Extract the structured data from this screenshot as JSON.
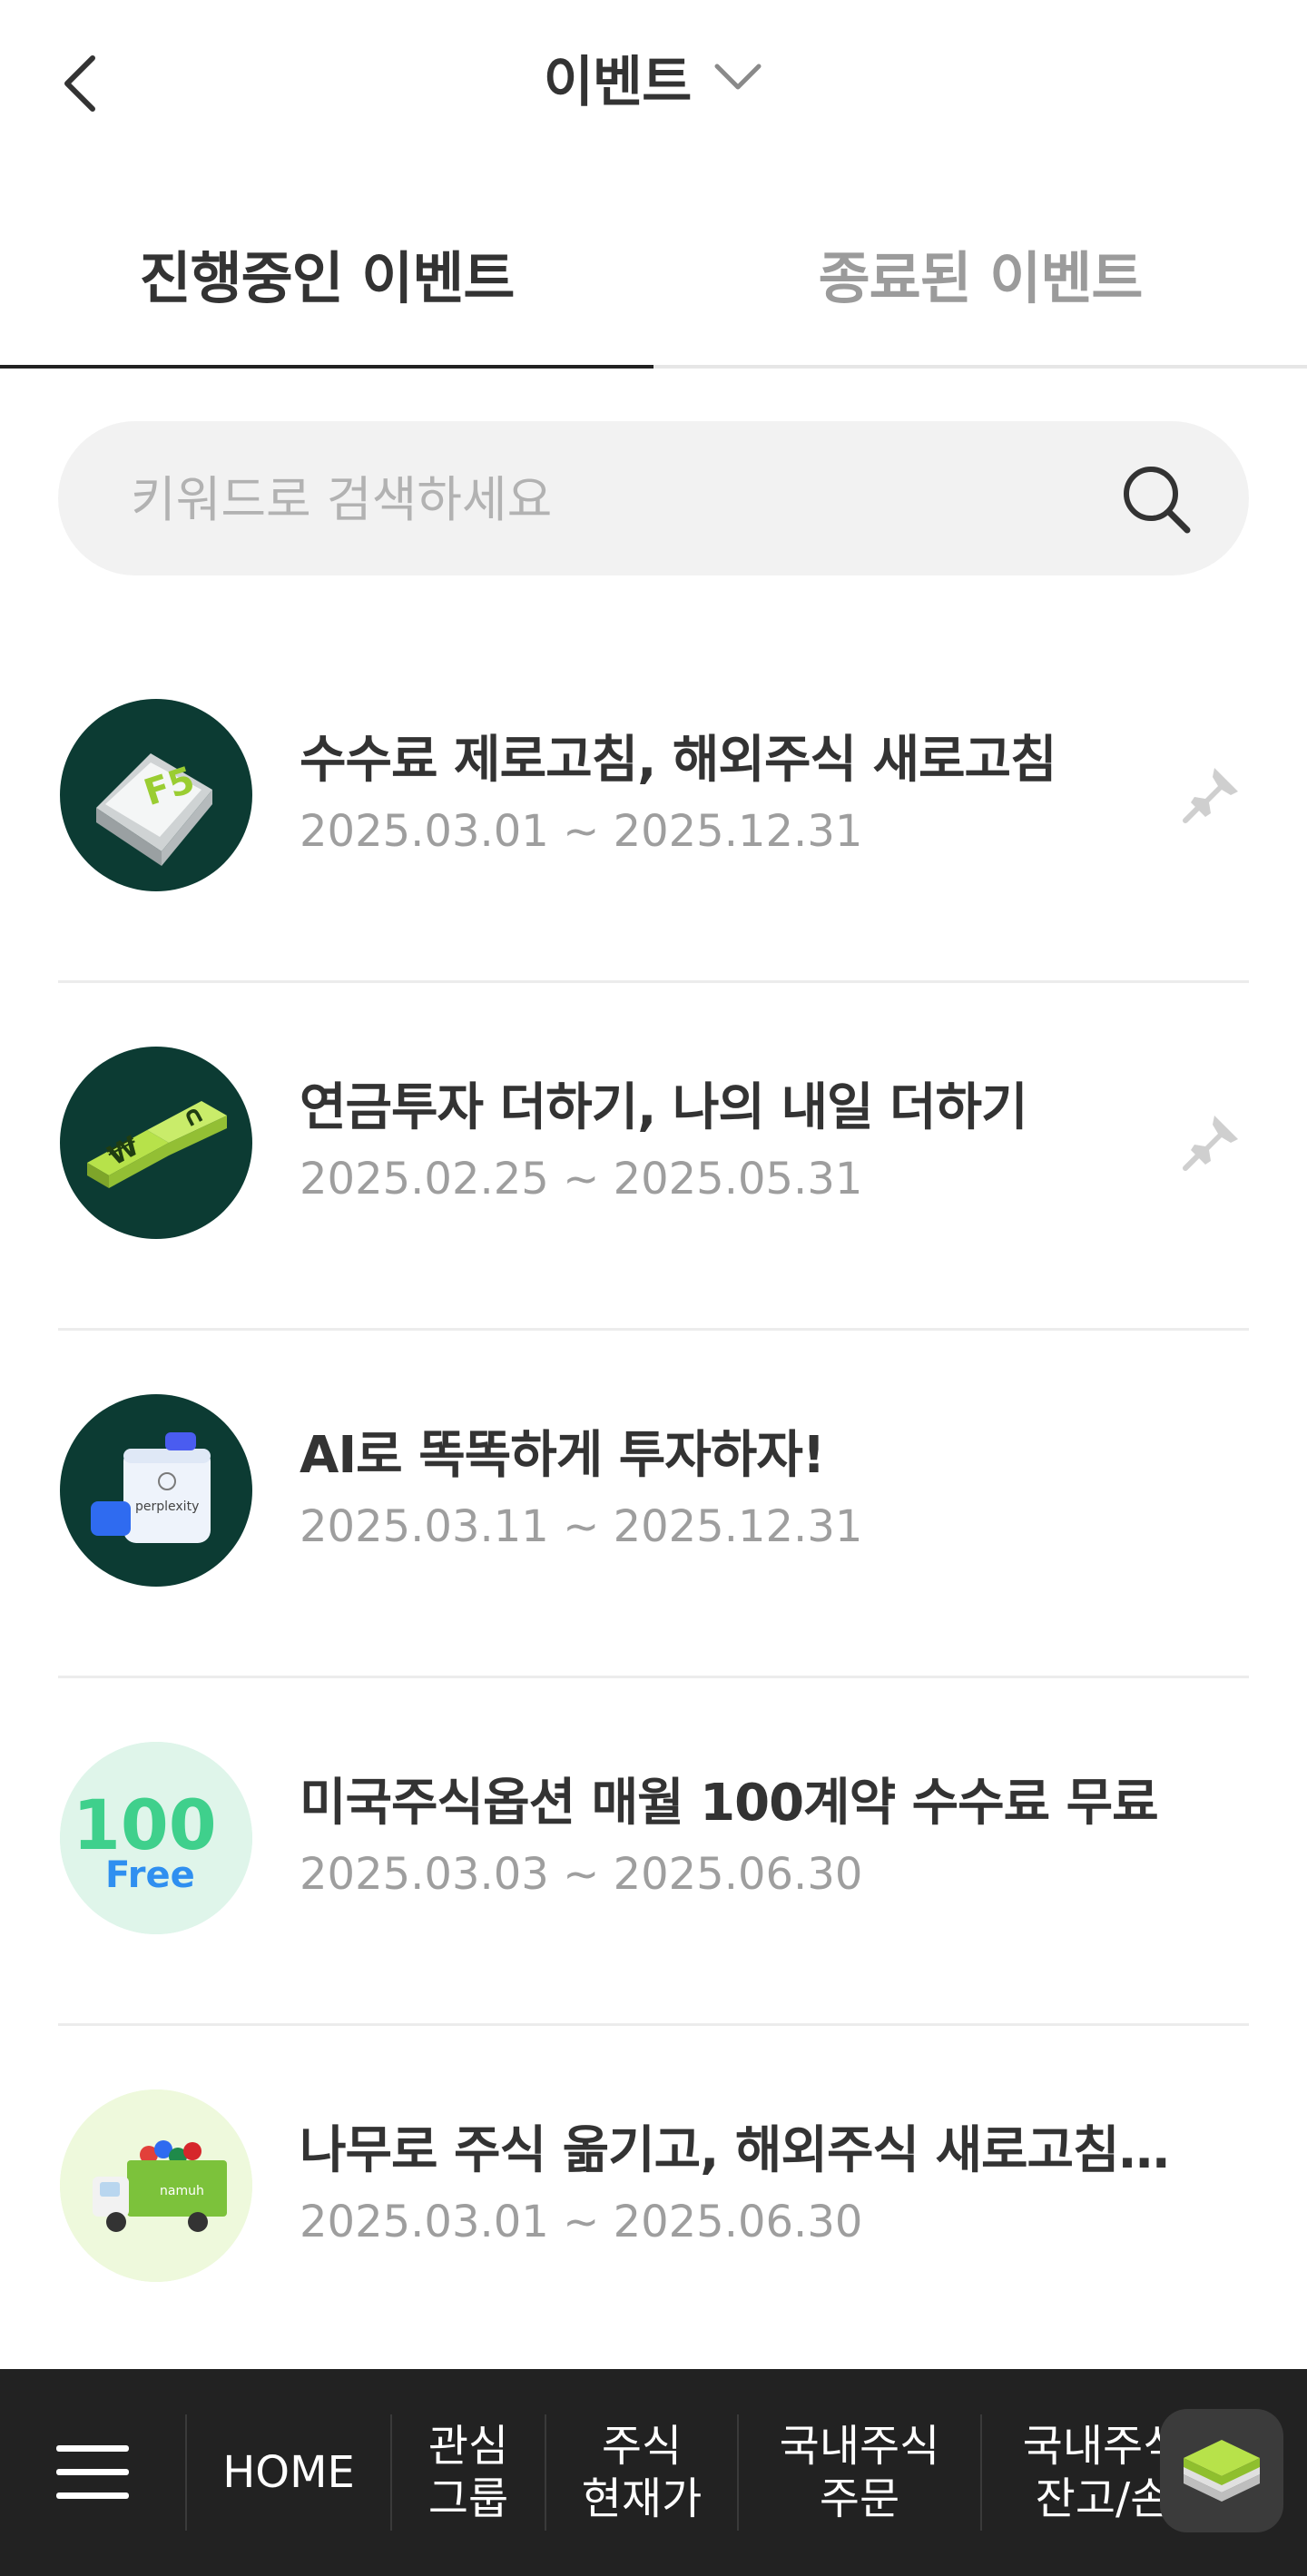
{
  "header": {
    "title": "이벤트",
    "back_icon": "chevron-left-icon",
    "caret_icon": "chevron-down-icon"
  },
  "tabs": [
    {
      "label": "진행중인 이벤트",
      "active": true
    },
    {
      "label": "종료된 이벤트",
      "active": false
    }
  ],
  "search": {
    "placeholder": "키워드로 검색하세요",
    "value": "",
    "icon": "search-icon"
  },
  "events": [
    {
      "title": "수수료 제로고침, 해외주식 새로고침",
      "date": "2025.03.01 ~ 2025.12.31",
      "pinned": true,
      "thumb_bg": "#0c3b33",
      "thumb_icon": "f5-key-icon"
    },
    {
      "title": "연금투자 더하기, 나의 내일 더하기",
      "date": "2025.02.25 ~ 2025.05.31",
      "pinned": true,
      "thumb_bg": "#0c3b33",
      "thumb_icon": "puzzle-icon"
    },
    {
      "title": "AI로 똑똑하게 투자하자!",
      "date": "2025.03.11 ~ 2025.12.31",
      "pinned": false,
      "thumb_bg": "#0c3b33",
      "thumb_icon": "perplexity-box-icon",
      "thumb_text": "perplexity"
    },
    {
      "title": "미국주식옵션 매월 100계약 수수료 무료",
      "date": "2025.03.03 ~ 2025.06.30",
      "pinned": false,
      "thumb_bg": "#d8f3e8",
      "thumb_icon": "100-free-icon",
      "thumb_text": "100",
      "thumb_text2": "Free"
    },
    {
      "title": "나무로 주식 옮기고, 해외주식 새로고침…",
      "date": "2025.03.01 ~ 2025.06.30",
      "pinned": false,
      "thumb_bg": "#eaf7d6",
      "thumb_icon": "truck-icon",
      "thumb_text": "namuh"
    }
  ],
  "bottom_nav": {
    "menu_icon": "hamburger-icon",
    "items": [
      {
        "label": "HOME"
      },
      {
        "label": "관심\n그룹"
      },
      {
        "label": "주식\n현재가"
      },
      {
        "label": "국내주식\n주문"
      },
      {
        "label": "국내주식\n잔고/손"
      }
    ],
    "layers_icon": "layers-icon"
  },
  "colors": {
    "accent_green": "#b7e24a",
    "dark_teal": "#0c3b33",
    "nav_bg": "#222222"
  }
}
